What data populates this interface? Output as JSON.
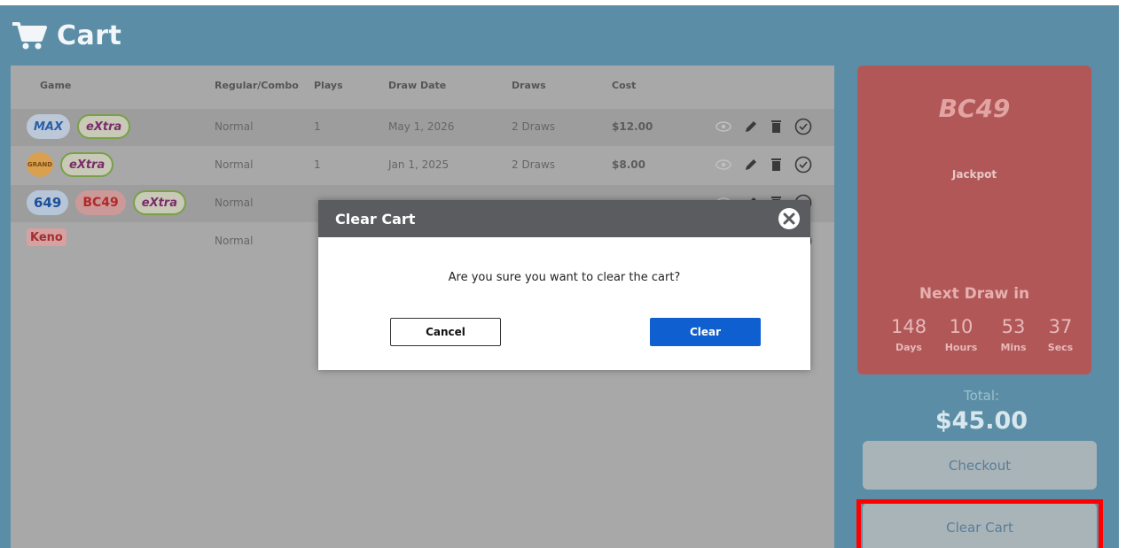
{
  "header": {
    "title": "Cart",
    "icon": "shopping-cart-icon"
  },
  "table": {
    "columns": [
      "Game",
      "Regular/Combo",
      "Plays",
      "Draw Date",
      "Draws",
      "Cost"
    ],
    "rows": [
      {
        "games": [
          "MAX",
          "eXtra"
        ],
        "type": "Normal",
        "plays": "1",
        "draw_date": "May 1, 2026",
        "draws": "2 Draws",
        "cost": "$12.00"
      },
      {
        "games": [
          "GRAND",
          "eXtra"
        ],
        "type": "Normal",
        "plays": "1",
        "draw_date": "Jan 1, 2025",
        "draws": "2 Draws",
        "cost": "$8.00"
      },
      {
        "games": [
          "649",
          "BC49",
          "eXtra"
        ],
        "type": "Normal",
        "plays": "",
        "draw_date": "",
        "draws": "",
        "cost": ""
      },
      {
        "games": [
          "Keno"
        ],
        "type": "Normal",
        "plays": "",
        "draw_date": "",
        "draws": "",
        "cost": ""
      }
    ]
  },
  "jackpot_panel": {
    "logo": "BC49",
    "jackpot_label": "Jackpot",
    "next_draw_label": "Next Draw in",
    "countdown": [
      {
        "value": "148",
        "unit": "Days"
      },
      {
        "value": "10",
        "unit": "Hours"
      },
      {
        "value": "53",
        "unit": "Mins"
      },
      {
        "value": "37",
        "unit": "Secs"
      }
    ],
    "color": "#b15757"
  },
  "summary": {
    "total_label": "Total:",
    "total_value": "$45.00",
    "checkout_label": "Checkout",
    "clear_cart_label": "Clear Cart"
  },
  "modal": {
    "title": "Clear Cart",
    "message": "Are you sure you want to clear the cart?",
    "cancel_label": "Cancel",
    "clear_label": "Clear",
    "clear_color": "#0f5fd0"
  },
  "colors": {
    "app_bg": "#5b8ea6",
    "highlight": "#ff0000"
  }
}
